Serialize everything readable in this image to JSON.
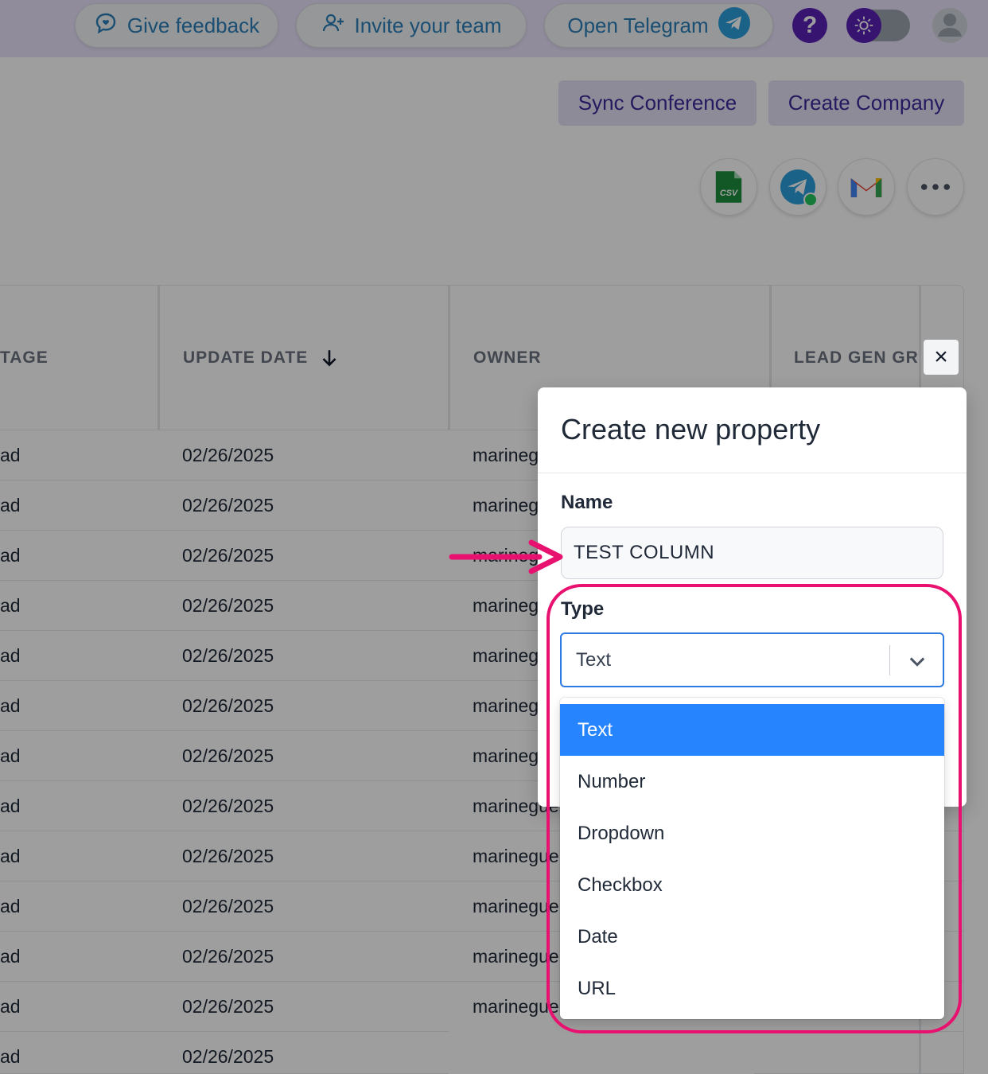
{
  "topbar": {
    "feedback_label": "Give feedback",
    "invite_label": "Invite your team",
    "telegram_label": "Open Telegram",
    "help_label": "?"
  },
  "actions": {
    "sync_label": "Sync Conference",
    "create_label": "Create Company",
    "csv_label": "CSV"
  },
  "table": {
    "columns": [
      "TAGE",
      "UPDATE DATE",
      "OWNER",
      "LEAD GEN GRO"
    ],
    "rows": [
      {
        "stage": "ad",
        "date": "02/26/2025",
        "owner": "marineg"
      },
      {
        "stage": "ad",
        "date": "02/26/2025",
        "owner": "marineg"
      },
      {
        "stage": "ad",
        "date": "02/26/2025",
        "owner": "marineg"
      },
      {
        "stage": "ad",
        "date": "02/26/2025",
        "owner": "marineg"
      },
      {
        "stage": "ad",
        "date": "02/26/2025",
        "owner": "marineg"
      },
      {
        "stage": "ad",
        "date": "02/26/2025",
        "owner": "marineg"
      },
      {
        "stage": "ad",
        "date": "02/26/2025",
        "owner": "marineg"
      },
      {
        "stage": "ad",
        "date": "02/26/2025",
        "owner": "marinegue"
      },
      {
        "stage": "ad",
        "date": "02/26/2025",
        "owner": "marinegue"
      },
      {
        "stage": "ad",
        "date": "02/26/2025",
        "owner": "marinegue"
      },
      {
        "stage": "ad",
        "date": "02/26/2025",
        "owner": "marinegue"
      },
      {
        "stage": "ad",
        "date": "02/26/2025",
        "owner": "marinegue"
      },
      {
        "stage": "ad",
        "date": "02/26/2025",
        "owner": ""
      }
    ]
  },
  "modal": {
    "title": "Create new property",
    "name_label": "Name",
    "name_value": "TEST COLUMN",
    "type_label": "Type",
    "type_value": "Text",
    "close_label": "×",
    "options": [
      "Text",
      "Number",
      "Dropdown",
      "Checkbox",
      "Date",
      "URL"
    ],
    "selected_option": "Text"
  },
  "colors": {
    "topbar_bg": "#e9e2fb",
    "accent": "#3b2a99",
    "select_border": "#2d7be0",
    "menu_selected": "#2684ff",
    "annotation": "#e8116f"
  }
}
